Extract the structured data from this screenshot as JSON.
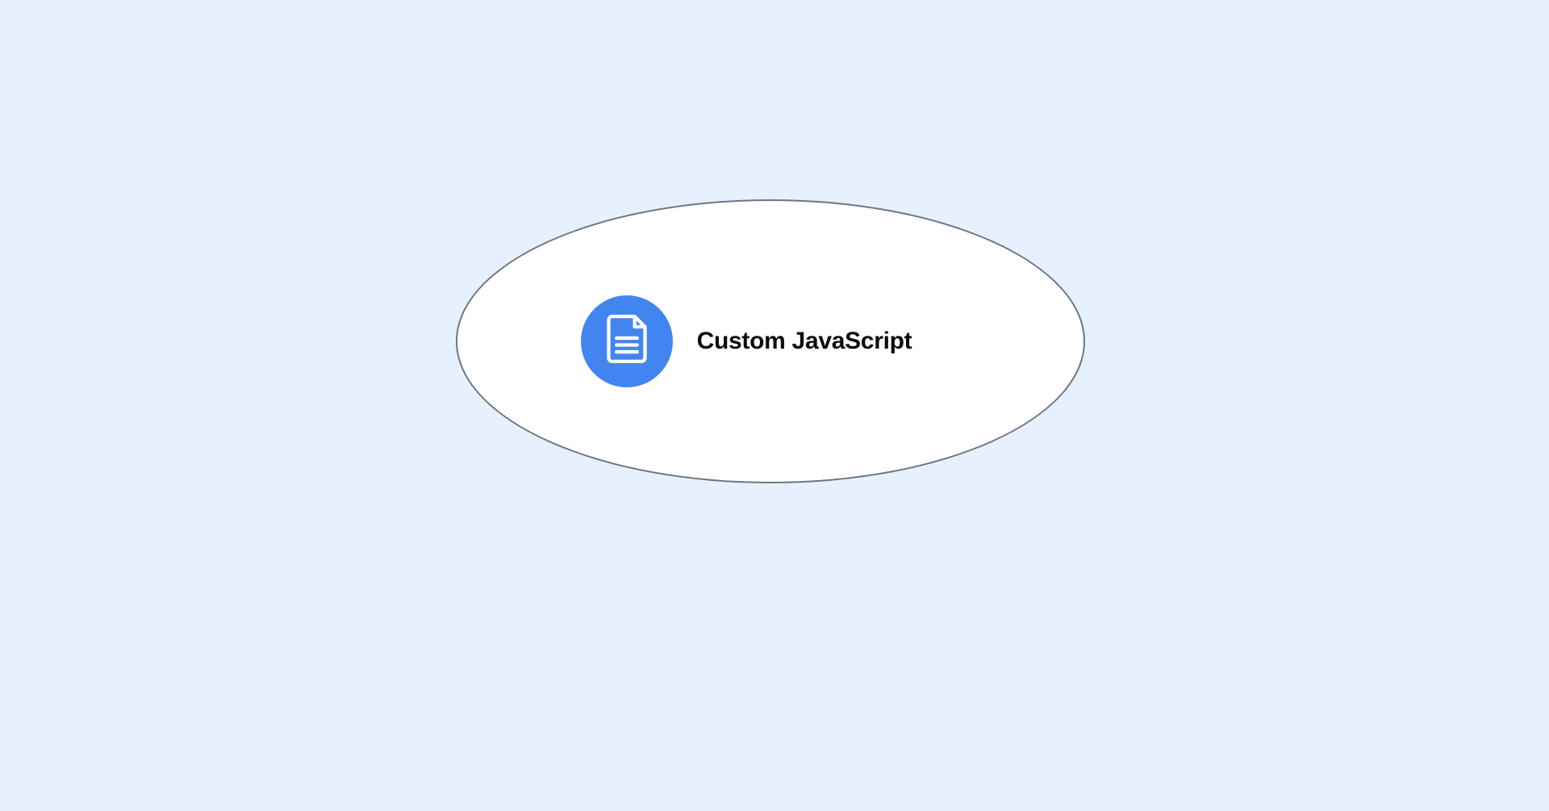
{
  "card": {
    "label": "Custom JavaScript",
    "icon": "document-icon",
    "colors": {
      "background": "#E7F1FE",
      "circle": "#4285F0",
      "border": "#6C7683",
      "text": "#0A0A0A"
    }
  }
}
